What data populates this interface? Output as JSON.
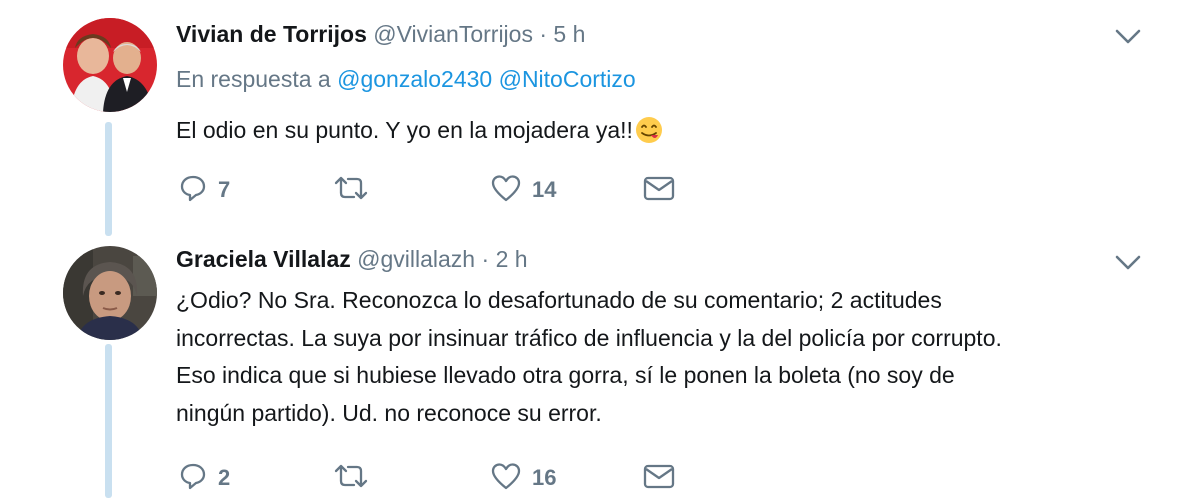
{
  "tweets": [
    {
      "name": "Vivian de Torrijos",
      "handle": "@VivianTorrijos",
      "dot": "·",
      "time": "5 h",
      "reply_prefix": "En respuesta a",
      "mentions": [
        "@gonzalo2430",
        "@NitoCortizo"
      ],
      "text_lines": [
        "El odio en su punto. Y yo en la mojadera ya!!"
      ],
      "emoji": "face-savoring-food-emoji",
      "replies": "7",
      "retweets": "",
      "likes": "14"
    },
    {
      "name": "Graciela Villalaz",
      "handle": "@gvillalazh",
      "dot": "·",
      "time": "2 h",
      "text_lines": [
        "¿Odio? No Sra. Reconozca lo desafortunado de su comentario; 2 actitudes",
        "incorrectas. La suya por insinuar tráfico de influencia y la del policía por corrupto.",
        "Eso indica que si hubiese llevado otra gorra, sí le ponen la boleta (no soy de",
        "ningún partido). Ud. no reconoce su error."
      ],
      "replies": "2",
      "retweets": "",
      "likes": "16"
    }
  ],
  "icons": {
    "reply": "reply-icon",
    "retweet": "retweet-icon",
    "like": "heart-icon",
    "dm": "envelope-icon",
    "caret": "chevron-down-icon"
  },
  "colors": {
    "text": "#14171a",
    "secondary": "#657786",
    "link": "#1b95e0",
    "thread_line": "#c9e0f0"
  }
}
